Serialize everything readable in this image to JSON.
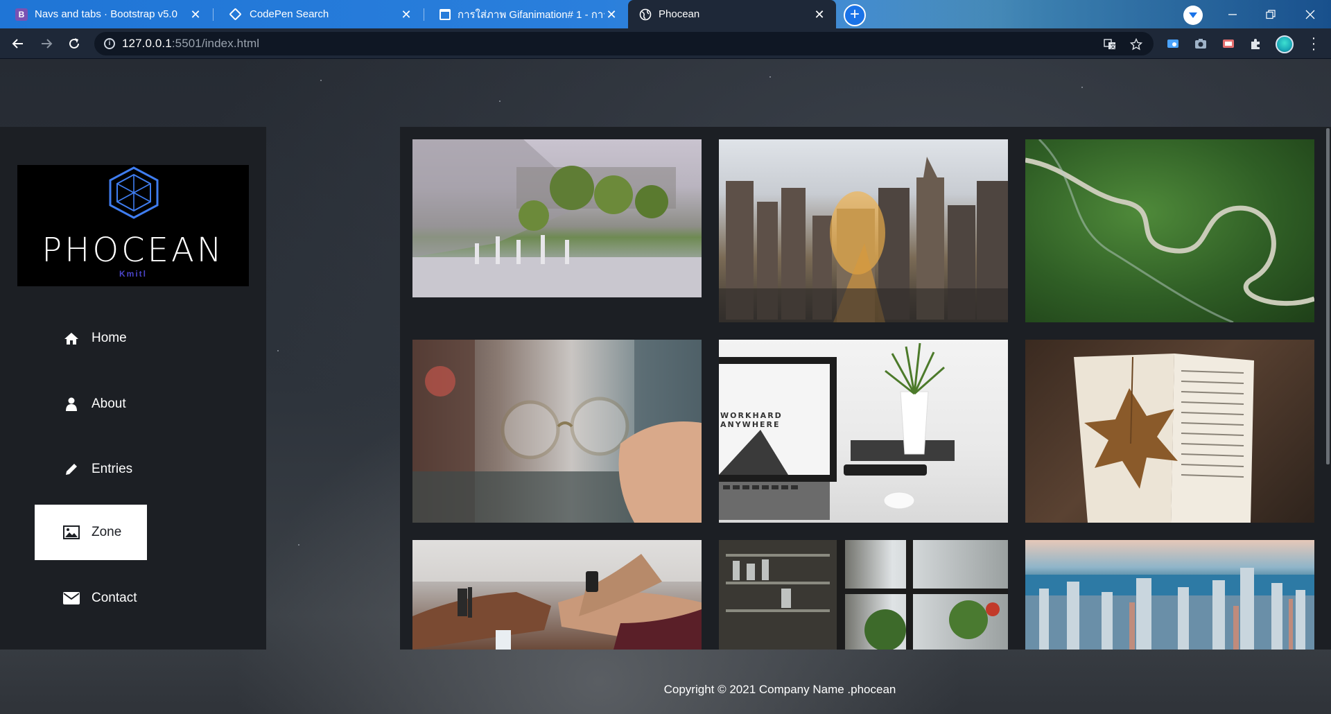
{
  "browser": {
    "tabs": [
      {
        "title": "Navs and tabs · Bootstrap v5.0",
        "icon": "bootstrap-icon",
        "active": false
      },
      {
        "title": "CodePen Search",
        "icon": "codepen-icon",
        "active": false
      },
      {
        "title": "การใส่ภาพ Gifanimation# 1 - การเขี",
        "icon": "doc-icon",
        "active": false
      },
      {
        "title": "Phocean",
        "icon": "globe-icon",
        "active": true
      }
    ],
    "url_host": "127.0.0.1",
    "url_path": ":5501/index.html",
    "new_tab_label": "+",
    "close_glyph": "✕"
  },
  "site": {
    "logo_text": "PHOCEAN",
    "logo_sub": "Kmitl",
    "nav": [
      {
        "label": "Home",
        "icon": "home-icon",
        "active": false
      },
      {
        "label": "About",
        "icon": "user-icon",
        "active": false
      },
      {
        "label": "Entries",
        "icon": "pencil-icon",
        "active": false
      },
      {
        "label": "Zone",
        "icon": "image-icon",
        "active": true
      },
      {
        "label": "Contact",
        "icon": "envelope-icon",
        "active": false
      }
    ],
    "gallery": [
      {
        "name": "campus-fountain"
      },
      {
        "name": "city-sunset-street"
      },
      {
        "name": "winding-road-forest"
      },
      {
        "name": "eyeglasses-in-hand"
      },
      {
        "name": "laptop-workspace"
      },
      {
        "name": "book-with-leaf"
      },
      {
        "name": "team-fist-bump"
      },
      {
        "name": "cafe-window-plants"
      },
      {
        "name": "city-skyline-lake"
      }
    ],
    "footer": "Copyright © 2021 Company Name .phocean"
  }
}
